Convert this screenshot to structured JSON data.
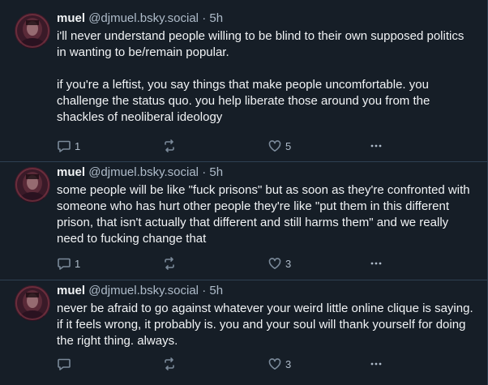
{
  "posts": [
    {
      "author": {
        "display_name": "muel",
        "handle": "@djmuel.bsky.social",
        "separator": "·",
        "time": "5h"
      },
      "text": "i'll never understand people willing to be blind to their own supposed politics in wanting to be/remain popular.\n\nif you're a leftist, you say things that make people uncomfortable. you challenge the status quo. you help liberate those around you from the shackles of neoliberal ideology",
      "stats": {
        "replies": "1",
        "reposts": "",
        "likes": "5"
      }
    },
    {
      "author": {
        "display_name": "muel",
        "handle": "@djmuel.bsky.social",
        "separator": "·",
        "time": "5h"
      },
      "text": "some people will be like \"fuck prisons\" but as soon as they're confronted with someone who has hurt other people they're like \"put them in this different prison, that isn't actually that different and still harms them\" and we really need to fucking change that",
      "stats": {
        "replies": "1",
        "reposts": "",
        "likes": "3"
      }
    },
    {
      "author": {
        "display_name": "muel",
        "handle": "@djmuel.bsky.social",
        "separator": "·",
        "time": "5h"
      },
      "text": "never be afraid to go against whatever your weird little online clique is saying. if it feels wrong, it probably is. you and your soul will thank yourself for doing the right thing. always.",
      "stats": {
        "replies": "",
        "reposts": "",
        "likes": "3"
      }
    }
  ],
  "icons": {
    "reply": "reply-icon",
    "repost": "repost-icon",
    "like": "heart-icon",
    "more": "more-options-icon"
  },
  "colors": {
    "background": "#161e27",
    "text": "#f1f3f5",
    "muted": "#aebbc9",
    "icon": "#7b8a9a",
    "divider": "#2e4052"
  }
}
